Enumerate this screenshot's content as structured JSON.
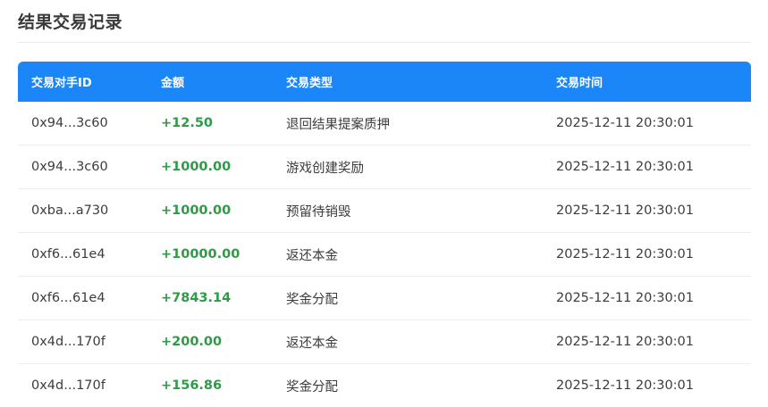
{
  "page": {
    "title": "结果交易记录"
  },
  "table": {
    "headers": {
      "counterparty": "交易对手ID",
      "amount": "金额",
      "type": "交易类型",
      "time": "交易时间"
    },
    "rows": [
      {
        "counterparty": "0x94...3c60",
        "amount": "+12.50",
        "type": "退回结果提案质押",
        "time": "2025-12-11 20:30:01"
      },
      {
        "counterparty": "0x94...3c60",
        "amount": "+1000.00",
        "type": "游戏创建奖励",
        "time": "2025-12-11 20:30:01"
      },
      {
        "counterparty": "0xba...a730",
        "amount": "+1000.00",
        "type": "预留待销毁",
        "time": "2025-12-11 20:30:01"
      },
      {
        "counterparty": "0xf6...61e4",
        "amount": "+10000.00",
        "type": "返还本金",
        "time": "2025-12-11 20:30:01"
      },
      {
        "counterparty": "0xf6...61e4",
        "amount": "+7843.14",
        "type": "奖金分配",
        "time": "2025-12-11 20:30:01"
      },
      {
        "counterparty": "0x4d...170f",
        "amount": "+200.00",
        "type": "返还本金",
        "time": "2025-12-11 20:30:01"
      },
      {
        "counterparty": "0x4d...170f",
        "amount": "+156.86",
        "type": "奖金分配",
        "time": "2025-12-11 20:30:01"
      }
    ]
  },
  "colors": {
    "header_background": "#1a86f7",
    "positive_amount": "#2e9b47"
  }
}
